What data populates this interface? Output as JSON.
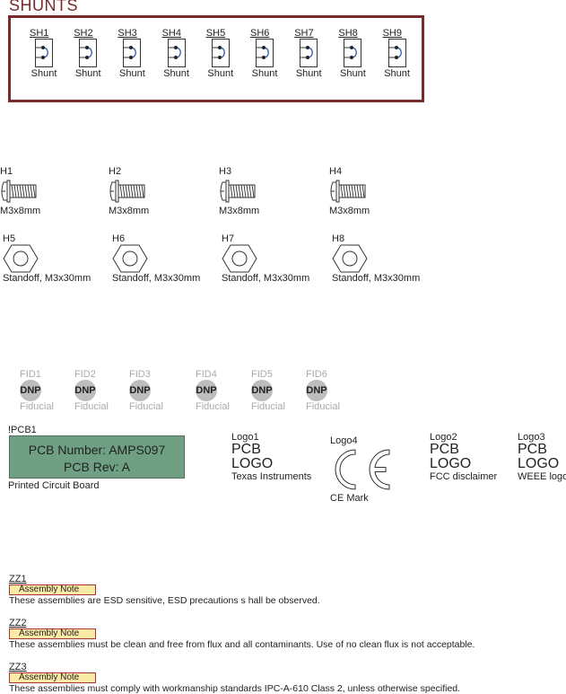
{
  "shunts_section": {
    "title": "SHUNTS",
    "items": [
      {
        "ref": "SH1",
        "label": "Shunt"
      },
      {
        "ref": "SH2",
        "label": "Shunt"
      },
      {
        "ref": "SH3",
        "label": "Shunt"
      },
      {
        "ref": "SH4",
        "label": "Shunt"
      },
      {
        "ref": "SH5",
        "label": "Shunt"
      },
      {
        "ref": "SH6",
        "label": "Shunt"
      },
      {
        "ref": "SH7",
        "label": "Shunt"
      },
      {
        "ref": "SH8",
        "label": "Shunt"
      },
      {
        "ref": "SH9",
        "label": "Shunt"
      }
    ],
    "border_color": "#7a2a2a",
    "jumper_color": "#3a5fb0"
  },
  "screws": [
    {
      "ref": "H1",
      "label": "M3x8mm",
      "icon": "screw-icon"
    },
    {
      "ref": "H2",
      "label": "M3x8mm",
      "icon": "screw-icon"
    },
    {
      "ref": "H3",
      "label": "M3x8mm",
      "icon": "screw-icon"
    },
    {
      "ref": "H4",
      "label": "M3x8mm",
      "icon": "screw-icon"
    }
  ],
  "standoffs": [
    {
      "ref": "H5",
      "label": "Standoff, M3x30mm",
      "icon": "hex-standoff-icon"
    },
    {
      "ref": "H6",
      "label": "Standoff, M3x30mm",
      "icon": "hex-standoff-icon"
    },
    {
      "ref": "H7",
      "label": "Standoff, M3x30mm",
      "icon": "hex-standoff-icon"
    },
    {
      "ref": "H8",
      "label": "Standoff, M3x30mm",
      "icon": "hex-standoff-icon"
    }
  ],
  "fiducials": [
    {
      "ref": "FID1",
      "badge": "DNP",
      "label": "Fiducial"
    },
    {
      "ref": "FID2",
      "badge": "DNP",
      "label": "Fiducial"
    },
    {
      "ref": "FID3",
      "badge": "DNP",
      "label": "Fiducial"
    },
    {
      "ref": "FID4",
      "badge": "DNP",
      "label": "Fiducial"
    },
    {
      "ref": "FID5",
      "badge": "DNP",
      "label": "Fiducial"
    },
    {
      "ref": "FID6",
      "badge": "DNP",
      "label": "Fiducial"
    }
  ],
  "pcb": {
    "ref": "!PCB1",
    "line1": "PCB Number: AMPS097",
    "line2": "PCB Rev: A",
    "label": "Printed Circuit Board",
    "fill_color": "#6fa084"
  },
  "logos": [
    {
      "ref": "Logo1",
      "line1": "PCB",
      "line2": "LOGO",
      "label": "Texas Instruments"
    },
    {
      "ref": "Logo4",
      "symbol": "CE",
      "label": "CE Mark"
    },
    {
      "ref": "Logo2",
      "line1": "PCB",
      "line2": "LOGO",
      "label": "FCC disclaimer"
    },
    {
      "ref": "Logo3",
      "line1": "PCB",
      "line2": "LOGO",
      "label": "WEEE logo"
    }
  ],
  "assembly_notes": [
    {
      "ref": "ZZ1",
      "badge": "Assembly Note",
      "text": "These assemblies are ESD sensitive, ESD precautions s hall be observed."
    },
    {
      "ref": "ZZ2",
      "badge": "Assembly Note",
      "text": "These assemblies must be clean and free from flux and all contaminants. Use of no clean flux is not acceptable."
    },
    {
      "ref": "ZZ3",
      "badge": "Assembly Note",
      "text": "These assemblies must comply with workmanship standards IPC-A-610 Class 2, unless otherwise specified."
    }
  ]
}
